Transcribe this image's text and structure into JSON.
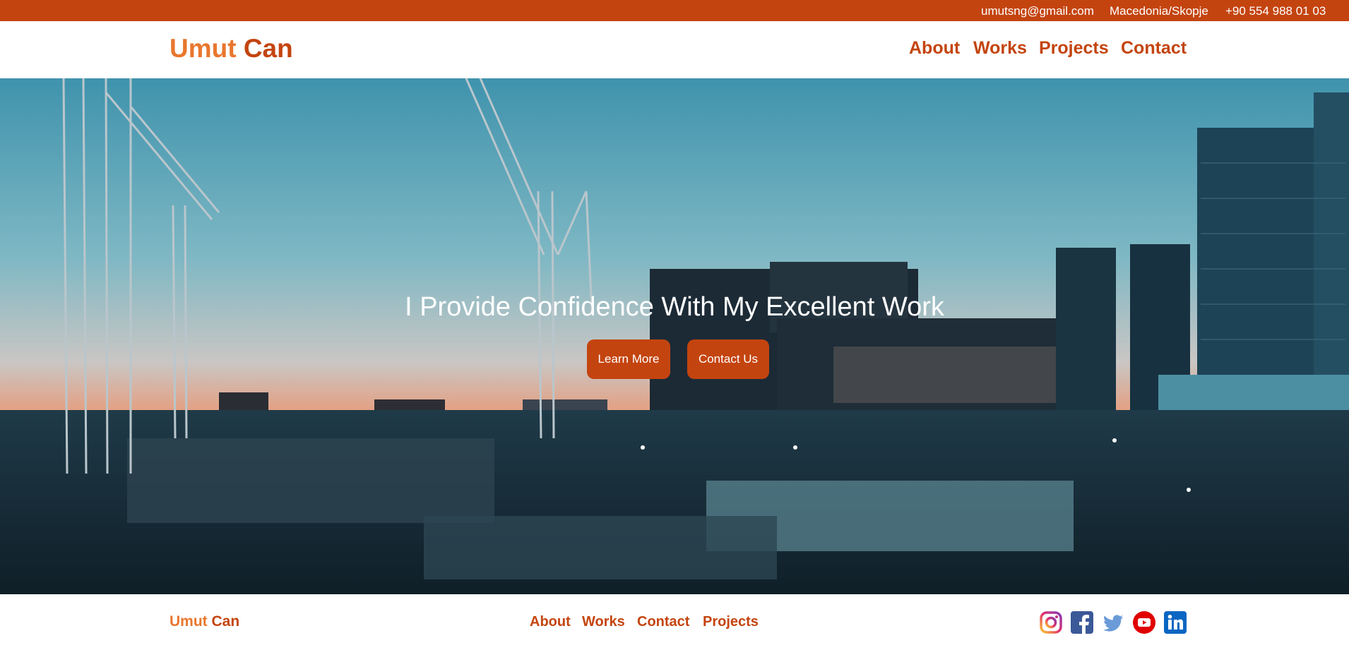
{
  "topbar": {
    "email": "umutsng@gmail.com",
    "location": "Macedonia/Skopje",
    "phone": "+90 554 988 01 03"
  },
  "header": {
    "brand_first": "Umut",
    "brand_second": "Can",
    "nav": {
      "about": "About",
      "works": "Works",
      "projects": "Projects",
      "contact": "Contact"
    }
  },
  "hero": {
    "title": "I Provide Confidence With My Excellent Work",
    "learn_more": "Learn More",
    "contact_us": "Contact Us",
    "background_icon": "construction-site-photo"
  },
  "footer": {
    "brand_first": "Umut",
    "brand_second": "Can",
    "nav": {
      "about": "About",
      "works": "Works",
      "contact": "Contact",
      "projects": "Projects"
    },
    "social": [
      "instagram-icon",
      "facebook-icon",
      "twitter-icon",
      "youtube-icon",
      "linkedin-icon"
    ]
  },
  "colors": {
    "brand": "#c4440f",
    "brand_light": "#e8772e",
    "white": "#ffffff"
  }
}
